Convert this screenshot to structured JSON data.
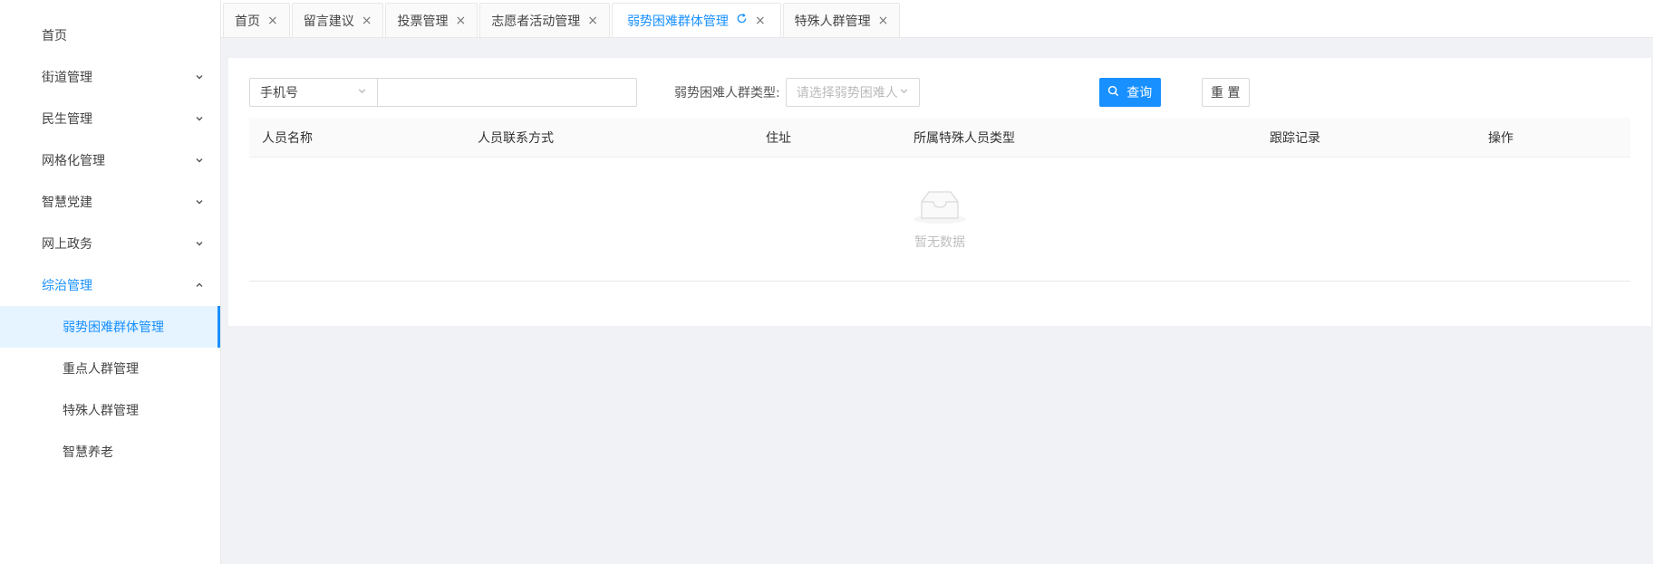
{
  "sidebar": {
    "items": [
      {
        "label": "首页",
        "has_children": false
      },
      {
        "label": "街道管理",
        "has_children": true
      },
      {
        "label": "民生管理",
        "has_children": true
      },
      {
        "label": "网格化管理",
        "has_children": true
      },
      {
        "label": "智慧党建",
        "has_children": true
      },
      {
        "label": "网上政务",
        "has_children": true
      },
      {
        "label": "综治管理",
        "has_children": true,
        "open": true
      }
    ],
    "submenu": [
      {
        "label": "弱势困难群体管理",
        "active": true
      },
      {
        "label": "重点人群管理"
      },
      {
        "label": "特殊人群管理"
      },
      {
        "label": "智慧养老"
      }
    ]
  },
  "tabs": [
    {
      "label": "首页"
    },
    {
      "label": "留言建议"
    },
    {
      "label": "投票管理"
    },
    {
      "label": "志愿者活动管理"
    },
    {
      "label": "弱势困难群体管理",
      "active": true
    },
    {
      "label": "特殊人群管理"
    }
  ],
  "filters": {
    "field_select_value": "手机号",
    "field_input_value": "",
    "type_label": "弱势困难人群类型:",
    "type_placeholder": "请选择弱势困难人...",
    "query_label": "查询",
    "reset_label": "重 置"
  },
  "table": {
    "columns": [
      "人员名称",
      "人员联系方式",
      "住址",
      "所属特殊人员类型",
      "跟踪记录",
      "操作"
    ],
    "empty_text": "暂无数据"
  },
  "colors": {
    "primary": "#1890ff",
    "active_menu_bg": "#e6f4ff",
    "page_bg": "#f0f2f5"
  }
}
